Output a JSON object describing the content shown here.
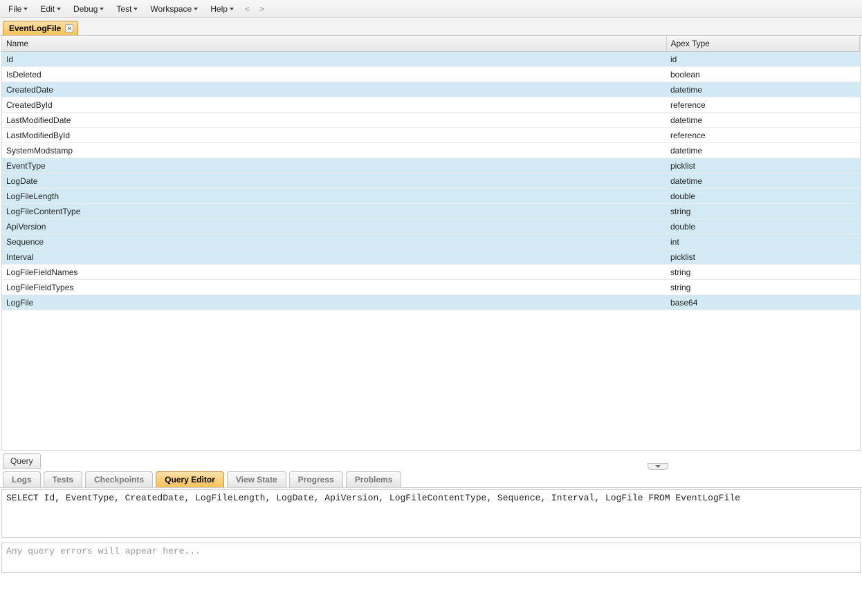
{
  "menu": {
    "file": "File",
    "edit": "Edit",
    "debug": "Debug",
    "test": "Test",
    "workspace": "Workspace",
    "help": "Help",
    "back": "<",
    "forward": ">"
  },
  "topTab": {
    "label": "EventLogFile",
    "close": "×"
  },
  "table": {
    "columns": {
      "name": "Name",
      "apex": "Apex Type"
    },
    "rows": [
      {
        "name": "Id",
        "type": "id",
        "hl": true
      },
      {
        "name": "IsDeleted",
        "type": "boolean",
        "hl": false
      },
      {
        "name": "CreatedDate",
        "type": "datetime",
        "hl": true
      },
      {
        "name": "CreatedById",
        "type": "reference",
        "hl": false
      },
      {
        "name": "LastModifiedDate",
        "type": "datetime",
        "hl": false
      },
      {
        "name": "LastModifiedById",
        "type": "reference",
        "hl": false
      },
      {
        "name": "SystemModstamp",
        "type": "datetime",
        "hl": false
      },
      {
        "name": "EventType",
        "type": "picklist",
        "hl": true
      },
      {
        "name": "LogDate",
        "type": "datetime",
        "hl": true
      },
      {
        "name": "LogFileLength",
        "type": "double",
        "hl": true
      },
      {
        "name": "LogFileContentType",
        "type": "string",
        "hl": true
      },
      {
        "name": "ApiVersion",
        "type": "double",
        "hl": true
      },
      {
        "name": "Sequence",
        "type": "int",
        "hl": true
      },
      {
        "name": "Interval",
        "type": "picklist",
        "hl": true
      },
      {
        "name": "LogFileFieldNames",
        "type": "string",
        "hl": false
      },
      {
        "name": "LogFileFieldTypes",
        "type": "string",
        "hl": false
      },
      {
        "name": "LogFile",
        "type": "base64",
        "hl": true
      }
    ]
  },
  "queryButton": "Query",
  "bottomTabs": {
    "logs": "Logs",
    "tests": "Tests",
    "checkpoints": "Checkpoints",
    "queryEditor": "Query Editor",
    "viewState": "View State",
    "progress": "Progress",
    "problems": "Problems"
  },
  "editor": {
    "value": "SELECT Id, EventType, CreatedDate, LogFileLength, LogDate, ApiVersion, LogFileContentType, Sequence, Interval, LogFile FROM EventLogFile"
  },
  "errors": {
    "placeholder": "Any query errors will appear here..."
  }
}
